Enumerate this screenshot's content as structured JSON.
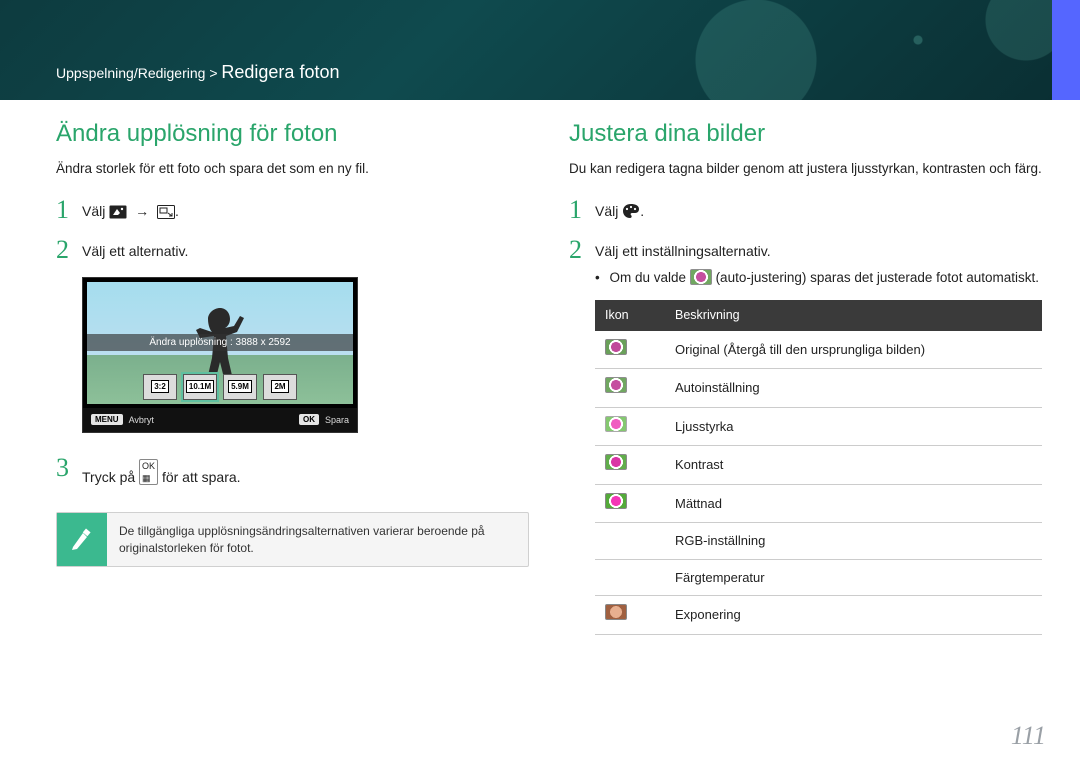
{
  "breadcrumb": {
    "path": "Uppspelning/Redigering >",
    "page": "Redigera foton"
  },
  "left": {
    "title": "Ändra upplösning för foton",
    "intro": "Ändra storlek för ett foto och spara det som en ny fil.",
    "step1_prefix": "Välj ",
    "step2": "Välj ett alternativ.",
    "step3_prefix": "Tryck på ",
    "step3_suffix": " för att spara.",
    "screen": {
      "label": "Ändra upplösning : 3888 x 2592",
      "options": [
        "3:2",
        "10.1M",
        "5.9M",
        "2M"
      ],
      "menu_key": "MENU",
      "menu_label": "Avbryt",
      "ok_key": "OK",
      "ok_label": "Spara"
    },
    "note": "De tillgängliga upplösningsändringsalternativen varierar beroende på originalstorleken för fotot."
  },
  "right": {
    "title": "Justera dina bilder",
    "intro": "Du kan redigera tagna bilder genom att justera ljusstyrkan, kontrasten och färg.",
    "step1_prefix": "Välj ",
    "step2": "Välj ett inställningsalternativ.",
    "sub_prefix": "Om du valde ",
    "sub_suffix": " (auto-justering) sparas det justerade fotot automatiskt.",
    "table": {
      "head_icon": "Ikon",
      "head_desc": "Beskrivning",
      "rows": [
        "Original (Återgå till den ursprungliga bilden)",
        "Autoinställning",
        "Ljusstyrka",
        "Kontrast",
        "Mättnad",
        "RGB-inställning",
        "Färgtemperatur",
        "Exponering"
      ]
    }
  },
  "page_number": "111"
}
